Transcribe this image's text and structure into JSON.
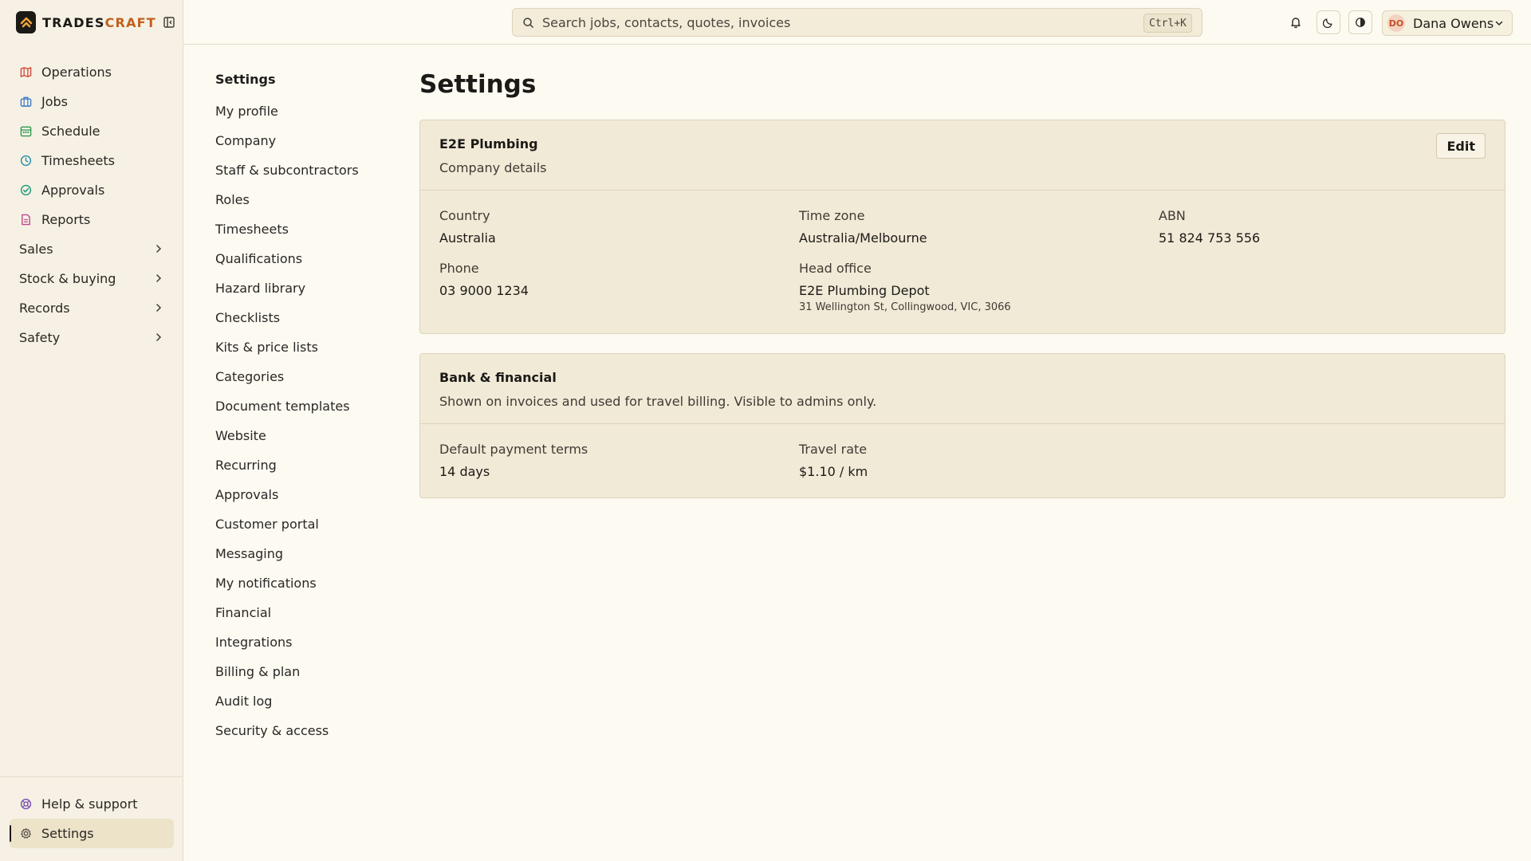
{
  "brand": {
    "name_main": "TRADES",
    "name_accent": "CRAFT"
  },
  "colors": {
    "accent": "#c2601e",
    "sidebar_bg": "#f6f1e4",
    "card_bg": "#f1ead7",
    "page_bg": "#fdfaf2"
  },
  "sidebar": {
    "items": [
      {
        "label": "Operations",
        "icon": "map-icon",
        "color": "#d0483a"
      },
      {
        "label": "Jobs",
        "icon": "briefcase-icon",
        "color": "#3d78c9"
      },
      {
        "label": "Schedule",
        "icon": "calendar-icon",
        "color": "#2f9a52"
      },
      {
        "label": "Timesheets",
        "icon": "clock-icon",
        "color": "#2a8fa8"
      },
      {
        "label": "Approvals",
        "icon": "check-circle-icon",
        "color": "#1f9a7a"
      },
      {
        "label": "Reports",
        "icon": "report-icon",
        "color": "#c0478e"
      }
    ],
    "groups": [
      {
        "label": "Sales"
      },
      {
        "label": "Stock & buying"
      },
      {
        "label": "Records"
      },
      {
        "label": "Safety"
      }
    ],
    "bottom": [
      {
        "label": "Help & support",
        "icon": "lifebuoy-icon",
        "color": "#7a4fb0"
      },
      {
        "label": "Settings",
        "icon": "gear-icon",
        "color": "#5a554b"
      }
    ]
  },
  "topbar": {
    "search_placeholder": "Search jobs, contacts, quotes, invoices",
    "shortcut": "Ctrl+K",
    "user_initials": "DO",
    "user_name": "Dana Owens"
  },
  "settings_nav": {
    "title": "Settings",
    "items": [
      "My profile",
      "Company",
      "Staff & subcontractors",
      "Roles",
      "Timesheets",
      "Qualifications",
      "Hazard library",
      "Checklists",
      "Kits & price lists",
      "Categories",
      "Document templates",
      "Website",
      "Recurring",
      "Approvals",
      "Customer portal",
      "Messaging",
      "My notifications",
      "Financial",
      "Integrations",
      "Billing & plan",
      "Audit log",
      "Security & access"
    ]
  },
  "main": {
    "title": "Settings",
    "company_card": {
      "title": "E2E Plumbing",
      "subtitle": "Company details",
      "edit_label": "Edit",
      "country_label": "Country",
      "country": "Australia",
      "timezone_label": "Time zone",
      "timezone": "Australia/Melbourne",
      "abn_label": "ABN",
      "abn": "51 824 753 556",
      "phone_label": "Phone",
      "phone": "03 9000 1234",
      "office_label": "Head office",
      "office_name": "E2E Plumbing Depot",
      "office_address": "31 Wellington St, Collingwood, VIC, 3066"
    },
    "bank_card": {
      "title": "Bank & financial",
      "subtitle": "Shown on invoices and used for travel billing. Visible to admins only.",
      "terms_label": "Default payment terms",
      "terms": "14 days",
      "rate_label": "Travel rate",
      "rate": "$1.10 / km"
    }
  }
}
